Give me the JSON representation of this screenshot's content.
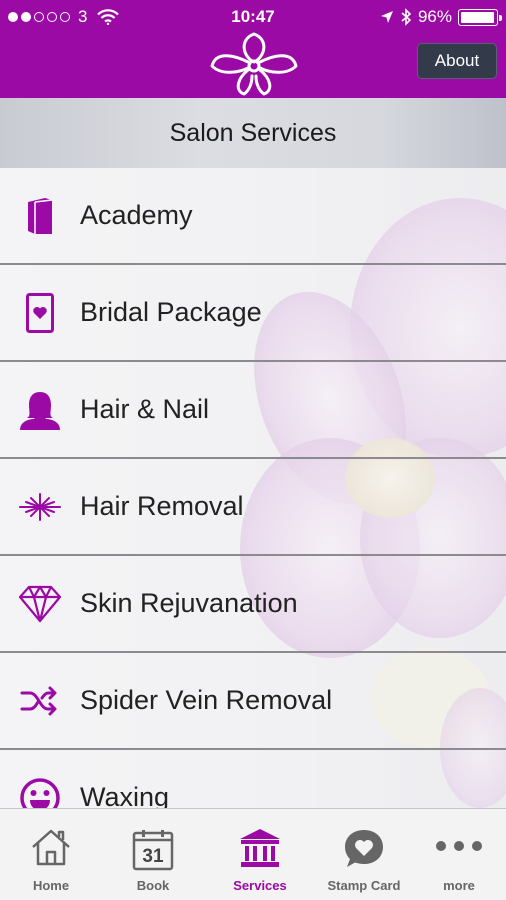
{
  "status_bar": {
    "carrier": "3",
    "time": "10:47",
    "battery": "96%",
    "battery_level": 0.96,
    "signal_dots_filled": 2
  },
  "header": {
    "about_label": "About"
  },
  "section": {
    "title": "Salon Services"
  },
  "services": [
    {
      "label": "Academy",
      "icon": "book-icon"
    },
    {
      "label": "Bridal Package",
      "icon": "heart-card-icon"
    },
    {
      "label": "Hair & Nail",
      "icon": "woman-silhouette-icon"
    },
    {
      "label": "Hair Removal",
      "icon": "laser-burst-icon"
    },
    {
      "label": "Skin Rejuvanation",
      "icon": "diamond-icon"
    },
    {
      "label": "Spider Vein Removal",
      "icon": "shuffle-icon"
    },
    {
      "label": "Waxing",
      "icon": "smiley-icon"
    }
  ],
  "tabs": [
    {
      "label": "Home",
      "icon": "home-icon",
      "active": false
    },
    {
      "label": "Book",
      "icon": "calendar-icon",
      "active": false,
      "calendar_day": "31"
    },
    {
      "label": "Services",
      "icon": "bank-icon",
      "active": true
    },
    {
      "label": "Stamp Card",
      "icon": "heart-bubble-icon",
      "active": false
    },
    {
      "label": "more",
      "icon": "more-dots-icon",
      "active": false
    }
  ],
  "colors": {
    "brand": "#9c0aa6",
    "button_dark": "#333a4a",
    "tab_inactive": "#666666"
  }
}
